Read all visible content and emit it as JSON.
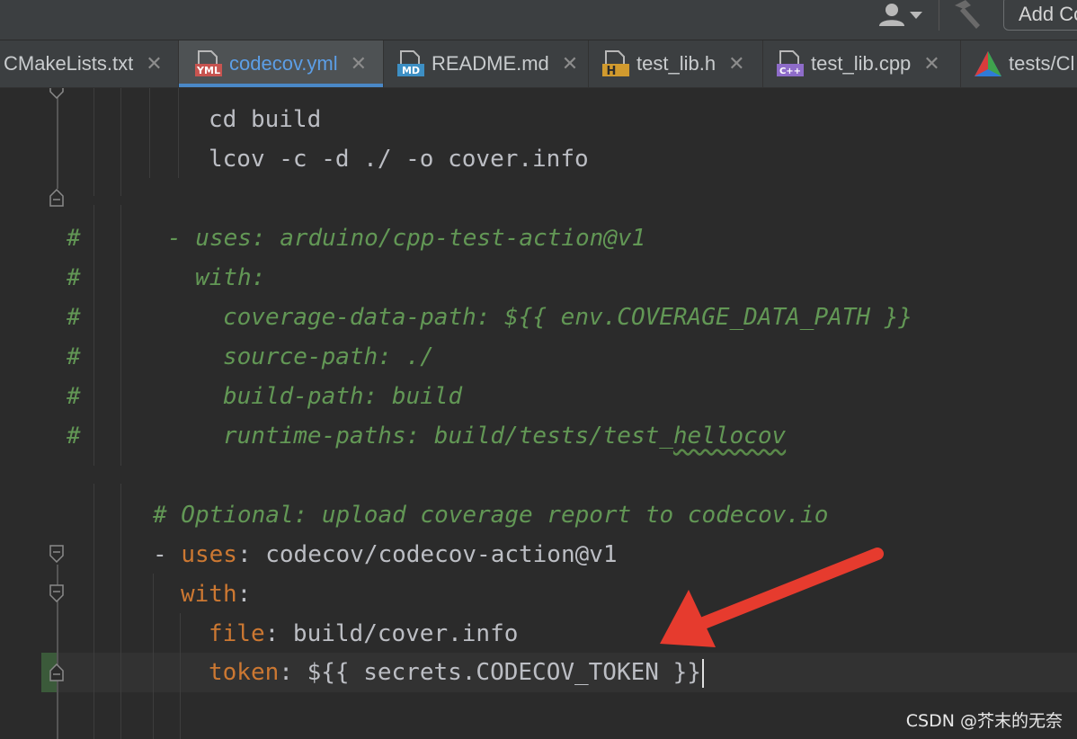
{
  "toolbar": {
    "user_icon": "user-dropdown-icon",
    "build_icon": "hammer-icon",
    "add_config_label": "Add Co"
  },
  "tabs": [
    {
      "label": "CMakeLists.txt",
      "icon": "cmake-icon"
    },
    {
      "label": "codecov.yml",
      "icon": "yml-file-icon",
      "icon_text": "YML",
      "active": true
    },
    {
      "label": "README.md",
      "icon": "markdown-file-icon",
      "icon_text": "MD"
    },
    {
      "label": "test_lib.h",
      "icon": "header-file-icon",
      "icon_text": "H"
    },
    {
      "label": "test_lib.cpp",
      "icon": "cpp-file-icon",
      "icon_text": "C++"
    },
    {
      "label": "tests/Cl",
      "icon": "cmake-triangle-icon"
    }
  ],
  "close_glyph": "✕",
  "code": {
    "l1": "cd build",
    "l2": "lcov -c -d ./ -o cover.info",
    "hash": "#",
    "c1": "- uses: arduino/cpp-test-action@v1",
    "c2": "with:",
    "c3": "coverage-data-path: ${{ env.COVERAGE_DATA_PATH }}",
    "c4": "source-path: ./",
    "c5": "build-path: build",
    "c6a": "runtime-paths: build/tests/test_",
    "c6b": "hellocov",
    "comment": "# Optional: upload coverage report to codecov.io",
    "uses_dash": "- ",
    "uses_key": "uses",
    "uses_val": ": codecov/codecov-action@v1",
    "with_key": "with",
    "with_colon": ":",
    "file_key": "file",
    "file_val": ": build/cover.info",
    "token_key": "token",
    "token_val": ": ${{ secrets.CODECOV_TOKEN }}"
  },
  "colors": {
    "background": "#2b2b2b",
    "comment": "#629755",
    "key": "#cc7832",
    "text": "#bcbec4",
    "active_tab_text": "#5c9ee6",
    "arrow": "#e63b2e"
  },
  "watermark": "CSDN @芥末的无奈"
}
